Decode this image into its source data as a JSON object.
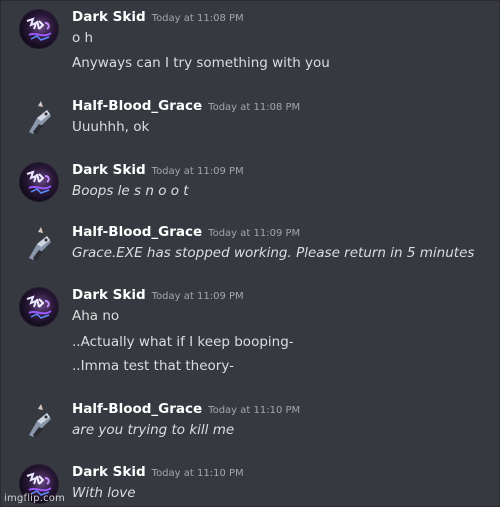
{
  "messages": [
    {
      "author": "Dark Skid",
      "timestamp": "Today at 11:08 PM",
      "avatar": "dark-skid-avatar",
      "lines": [
        "o h",
        "Anyways can I try something with you"
      ]
    },
    {
      "author": "Half-Blood_Grace",
      "timestamp": "Today at 11:08 PM",
      "avatar": "half-blood-grace-avatar",
      "lines": [
        "Uuuhhh, ok"
      ]
    },
    {
      "author": "Dark Skid",
      "timestamp": "Today at 11:09 PM",
      "avatar": "dark-skid-avatar",
      "lines": [
        "Boops le s n o o t"
      ]
    },
    {
      "author": "Half-Blood_Grace",
      "timestamp": "Today at 11:09 PM",
      "avatar": "half-blood-grace-avatar",
      "lines": [
        "Grace.EXE has stopped working. Please return in 5 minutes"
      ]
    },
    {
      "author": "Dark Skid",
      "timestamp": "Today at 11:09 PM",
      "avatar": "dark-skid-avatar",
      "lines": [
        "Aha no",
        "..Actually what if I keep booping-",
        "..Imma test that theory-"
      ]
    },
    {
      "author": "Half-Blood_Grace",
      "timestamp": "Today at 11:10 PM",
      "avatar": "half-blood-grace-avatar",
      "lines": [
        "are you trying to kill me"
      ]
    },
    {
      "author": "Dark Skid",
      "timestamp": "Today at 11:10 PM",
      "avatar": "dark-skid-avatar",
      "lines": [
        "With love"
      ]
    }
  ],
  "watermark": "imgflip.com",
  "colors": {
    "background": "#36393f",
    "author": "#ffffff",
    "text": "#dcddde",
    "timestamp": "#a3a6aa"
  }
}
